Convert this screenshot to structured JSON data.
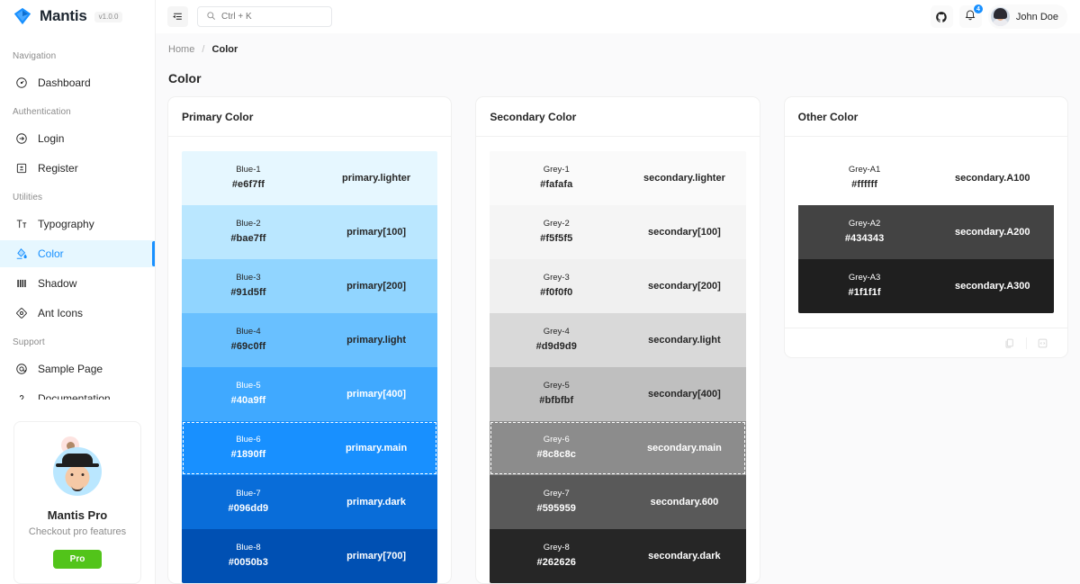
{
  "brand": {
    "name": "Mantis",
    "version": "v1.0.0",
    "logo_icon": "gem-diamond-icon"
  },
  "sidebar": {
    "groups": [
      {
        "title": "Navigation",
        "items": [
          {
            "label": "Dashboard",
            "icon": "dashboard-gauge-icon",
            "active": false
          }
        ]
      },
      {
        "title": "Authentication",
        "items": [
          {
            "label": "Login",
            "icon": "login-arrow-icon",
            "active": false
          },
          {
            "label": "Register",
            "icon": "register-form-icon",
            "active": false
          }
        ]
      },
      {
        "title": "Utilities",
        "items": [
          {
            "label": "Typography",
            "icon": "typography-icon",
            "active": false
          },
          {
            "label": "Color",
            "icon": "color-palette-icon",
            "active": true
          },
          {
            "label": "Shadow",
            "icon": "shadow-icon",
            "active": false
          },
          {
            "label": "Ant Icons",
            "icon": "ant-icons-icon",
            "active": false
          }
        ]
      },
      {
        "title": "Support",
        "items": [
          {
            "label": "Sample Page",
            "icon": "sample-page-icon",
            "active": false
          },
          {
            "label": "Documentation",
            "icon": "question-mark-icon",
            "active": false
          }
        ]
      }
    ],
    "pro_card": {
      "title": "Mantis Pro",
      "subtitle": "Checkout pro features",
      "button_label": "Pro",
      "button_color": "#52c41a"
    }
  },
  "topbar": {
    "menu_toggle_icon": "menu-collapse-icon",
    "search": {
      "placeholder": "Ctrl + K",
      "value": "",
      "icon": "search-icon"
    },
    "github_icon": "github-icon",
    "notification": {
      "icon": "bell-icon",
      "badge_count": "4",
      "badge_color": "#1890ff"
    },
    "profile": {
      "name": "John Doe",
      "avatar_icon": "user-avatar"
    }
  },
  "breadcrumb": {
    "home": "Home",
    "separator": "/",
    "current": "Color"
  },
  "page": {
    "title": "Color"
  },
  "cards": [
    {
      "title": "Primary Color",
      "rows": [
        {
          "name": "Blue-1",
          "hex": "#e6f7ff",
          "token": "primary.lighter",
          "bg": "#e6f7ff",
          "text": "#262626",
          "highlight": false
        },
        {
          "name": "Blue-2",
          "hex": "#bae7ff",
          "token": "primary[100]",
          "bg": "#bae7ff",
          "text": "#262626",
          "highlight": false
        },
        {
          "name": "Blue-3",
          "hex": "#91d5ff",
          "token": "primary[200]",
          "bg": "#91d5ff",
          "text": "#262626",
          "highlight": false
        },
        {
          "name": "Blue-4",
          "hex": "#69c0ff",
          "token": "primary.light",
          "bg": "#69c0ff",
          "text": "#262626",
          "highlight": false
        },
        {
          "name": "Blue-5",
          "hex": "#40a9ff",
          "token": "primary[400]",
          "bg": "#40a9ff",
          "text": "#ffffff",
          "highlight": false
        },
        {
          "name": "Blue-6",
          "hex": "#1890ff",
          "token": "primary.main",
          "bg": "#1890ff",
          "text": "#ffffff",
          "highlight": true
        },
        {
          "name": "Blue-7",
          "hex": "#096dd9",
          "token": "primary.dark",
          "bg": "#096dd9",
          "text": "#ffffff",
          "highlight": false
        },
        {
          "name": "Blue-8",
          "hex": "#0050b3",
          "token": "primary[700]",
          "bg": "#0050b3",
          "text": "#ffffff",
          "highlight": false
        }
      ],
      "footer_icons": []
    },
    {
      "title": "Secondary Color",
      "rows": [
        {
          "name": "Grey-1",
          "hex": "#fafafa",
          "token": "secondary.lighter",
          "bg": "#fafafa",
          "text": "#262626",
          "highlight": false
        },
        {
          "name": "Grey-2",
          "hex": "#f5f5f5",
          "token": "secondary[100]",
          "bg": "#f5f5f5",
          "text": "#262626",
          "highlight": false
        },
        {
          "name": "Grey-3",
          "hex": "#f0f0f0",
          "token": "secondary[200]",
          "bg": "#f0f0f0",
          "text": "#262626",
          "highlight": false
        },
        {
          "name": "Grey-4",
          "hex": "#d9d9d9",
          "token": "secondary.light",
          "bg": "#d9d9d9",
          "text": "#262626",
          "highlight": false
        },
        {
          "name": "Grey-5",
          "hex": "#bfbfbf",
          "token": "secondary[400]",
          "bg": "#bfbfbf",
          "text": "#262626",
          "highlight": false
        },
        {
          "name": "Grey-6",
          "hex": "#8c8c8c",
          "token": "secondary.main",
          "bg": "#8c8c8c",
          "text": "#ffffff",
          "highlight": true
        },
        {
          "name": "Grey-7",
          "hex": "#595959",
          "token": "secondary.600",
          "bg": "#595959",
          "text": "#ffffff",
          "highlight": false
        },
        {
          "name": "Grey-8",
          "hex": "#262626",
          "token": "secondary.dark",
          "bg": "#262626",
          "text": "#ffffff",
          "highlight": false
        }
      ],
      "footer_icons": []
    },
    {
      "title": "Other Color",
      "rows": [
        {
          "name": "Grey-A1",
          "hex": "#ffffff",
          "token": "secondary.A100",
          "bg": "#ffffff",
          "text": "#262626",
          "highlight": false
        },
        {
          "name": "Grey-A2",
          "hex": "#434343",
          "token": "secondary.A200",
          "bg": "#434343",
          "text": "#ffffff",
          "highlight": false
        },
        {
          "name": "Grey-A3",
          "hex": "#1f1f1f",
          "token": "secondary.A300",
          "bg": "#1f1f1f",
          "text": "#ffffff",
          "highlight": false
        }
      ],
      "footer_icons": [
        "copy-icon",
        "code-snippet-icon"
      ]
    }
  ]
}
